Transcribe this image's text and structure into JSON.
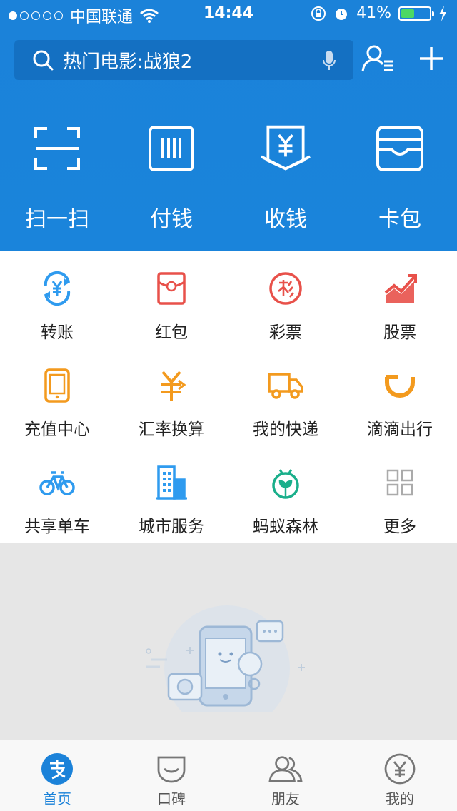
{
  "status": {
    "carrier": "中国联通",
    "time": "14:44",
    "battery": "41%"
  },
  "search": {
    "placeholder": "热门电影:战狼2"
  },
  "actions": [
    {
      "label": "扫一扫",
      "icon": "scan-icon"
    },
    {
      "label": "付钱",
      "icon": "barcode-pay-icon"
    },
    {
      "label": "收钱",
      "icon": "yuan-receive-icon"
    },
    {
      "label": "卡包",
      "icon": "card-wallet-icon"
    }
  ],
  "services": [
    {
      "label": "转账",
      "icon": "transfer-icon",
      "color": "#2f9bef"
    },
    {
      "label": "红包",
      "icon": "red-envelope-icon",
      "color": "#e8514a"
    },
    {
      "label": "彩票",
      "icon": "lottery-icon",
      "color": "#e8514a"
    },
    {
      "label": "股票",
      "icon": "stock-chart-icon",
      "color": "#e8514a"
    },
    {
      "label": "充值中心",
      "icon": "phone-recharge-icon",
      "color": "#f39a1e"
    },
    {
      "label": "汇率换算",
      "icon": "exchange-rate-icon",
      "color": "#f39a1e"
    },
    {
      "label": "我的快递",
      "icon": "delivery-truck-icon",
      "color": "#f39a1e"
    },
    {
      "label": "滴滴出行",
      "icon": "didi-icon",
      "color": "#f39a1e"
    },
    {
      "label": "共享单车",
      "icon": "bicycle-icon",
      "color": "#2f9bef"
    },
    {
      "label": "城市服务",
      "icon": "city-building-icon",
      "color": "#2f9bef"
    },
    {
      "label": "蚂蚁森林",
      "icon": "ant-forest-icon",
      "color": "#1aaf8b"
    },
    {
      "label": "更多",
      "icon": "more-grid-icon",
      "color": "#aaaaaa"
    }
  ],
  "tabs": [
    {
      "label": "首页",
      "icon": "alipay-home-icon",
      "active": true
    },
    {
      "label": "口碑",
      "icon": "koubei-icon",
      "active": false
    },
    {
      "label": "朋友",
      "icon": "friends-icon",
      "active": false
    },
    {
      "label": "我的",
      "icon": "my-yuan-icon",
      "active": false
    }
  ],
  "colors": {
    "brand_blue": "#1b82d9",
    "search_bg": "#1470c2",
    "battery_green": "#4cd964"
  }
}
